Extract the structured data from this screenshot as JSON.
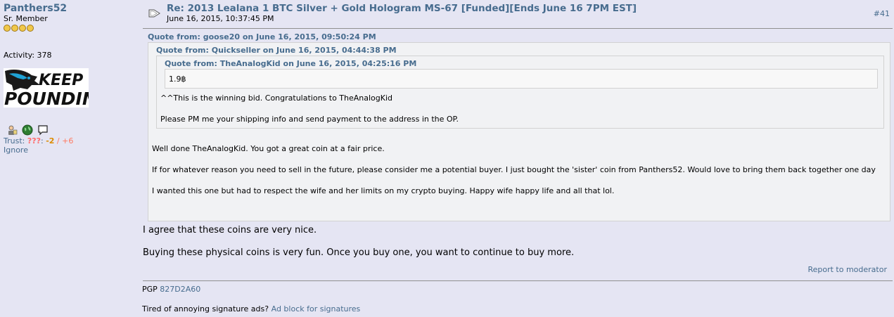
{
  "poster": {
    "username": "Panthers52",
    "rank": "Sr. Member",
    "activity": "Activity: 378",
    "avatar_text_line1": "KEEP",
    "avatar_text_line2": "POUNDING",
    "trust_label": "Trust: ",
    "trust_unknown": "???",
    "trust_negative": "-2",
    "trust_separator": " / ",
    "trust_positive": "+6",
    "ignore": "Ignore"
  },
  "post": {
    "subject": "Re: 2013 Lealana 1 BTC Silver + Gold Hologram MS-67 [Funded][Ends June 16 7PM EST]",
    "date": "June 16, 2015, 10:37:45 PM",
    "number": "#41",
    "quote1_header": "Quote from: goose20 on June 16, 2015, 09:50:24 PM",
    "quote2_header": "Quote from: Quickseller on June 16, 2015, 04:44:38 PM",
    "quote3_header": "Quote from: TheAnalogKid on June 16, 2015, 04:25:16 PM",
    "quote3_text": "1.9฿",
    "quote2_line1": "^^This is the winning bid. Congratulations to TheAnalogKid",
    "quote2_line2": "Please PM me your shipping info and send payment to the address in the OP.",
    "quote1_line1": "Well done TheAnalogKid. You got a great coin at a fair price.",
    "quote1_line2": "If for whatever reason you need to sell in the future, please consider me a potential buyer.  I just bought the 'sister' coin from Panthers52. Would love to bring them back together one day",
    "quote1_line3": "I wanted this one but had to respect the wife and her limits on my crypto buying. Happy wife happy life and all that lol.",
    "body_line1": "I agree that these coins are very nice.",
    "body_line2": "Buying these physical coins is very fun. Once you buy one, you want to continue to buy more.",
    "report": "Report to moderator"
  },
  "signature": {
    "pgp_label": "PGP ",
    "pgp_key": "827D2A60",
    "ad_text": "Tired of annoying signature ads? ",
    "ad_link": "Ad block for signatures"
  },
  "colors": {
    "background": "#e5e5f3",
    "link": "#476c8e",
    "quote_bg": "#f1f2f4",
    "trust_negative": "#dc8c00",
    "trust_positive": "#ff7a60"
  }
}
